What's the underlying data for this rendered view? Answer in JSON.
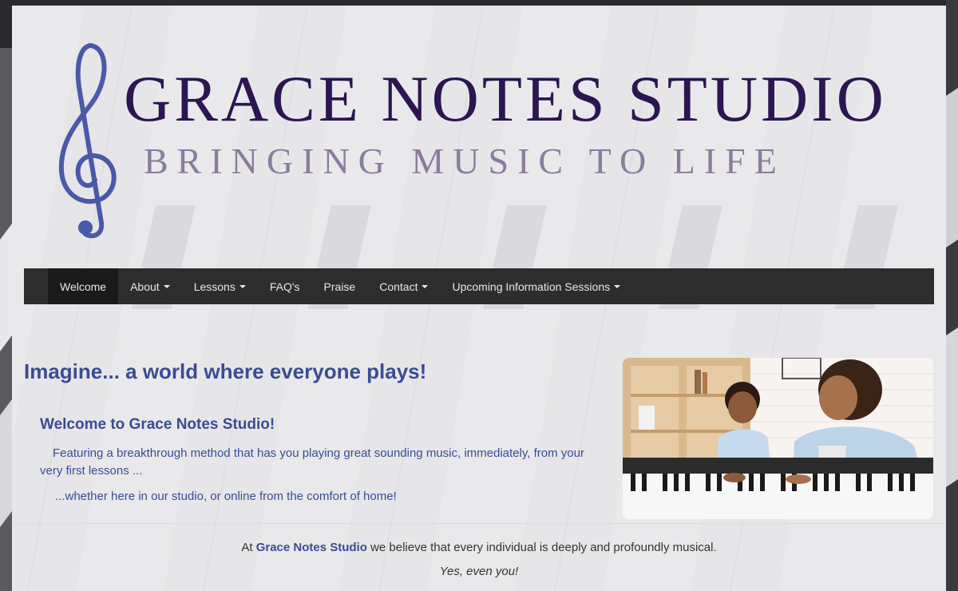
{
  "header": {
    "title": "GRACE NOTES STUDIO",
    "tagline": "BRINGING MUSIC TO LIFE",
    "logo_icon": "treble-clef-icon"
  },
  "nav": {
    "items": [
      {
        "label": "Welcome",
        "active": true,
        "dropdown": false
      },
      {
        "label": "About",
        "active": false,
        "dropdown": true
      },
      {
        "label": "Lessons",
        "active": false,
        "dropdown": true
      },
      {
        "label": "FAQ's",
        "active": false,
        "dropdown": false
      },
      {
        "label": "Praise",
        "active": false,
        "dropdown": false
      },
      {
        "label": "Contact",
        "active": false,
        "dropdown": true
      },
      {
        "label": "Upcoming Information Sessions",
        "active": false,
        "dropdown": true
      }
    ]
  },
  "main": {
    "headline": "Imagine... a world where everyone plays!",
    "welcome_title": "Welcome to Grace Notes Studio!",
    "intro": "Featuring a breakthrough method that has you playing great sounding music, immediately, from your very first lessons ...",
    "intro_2": "...whether here in our studio, or online from the comfort of home!"
  },
  "footer_text": {
    "belief_prefix": "At ",
    "belief_name": "Grace Notes Studio",
    "belief_suffix": " we believe that every individual is deeply and profoundly musical.",
    "even_you": "Yes, even you!"
  },
  "colors": {
    "title": "#2c1550",
    "tagline": "#8b7b9c",
    "accent_blue": "#394c94",
    "nav_bg": "#2d2d2e",
    "logo_clef": "#4a5aa8"
  }
}
